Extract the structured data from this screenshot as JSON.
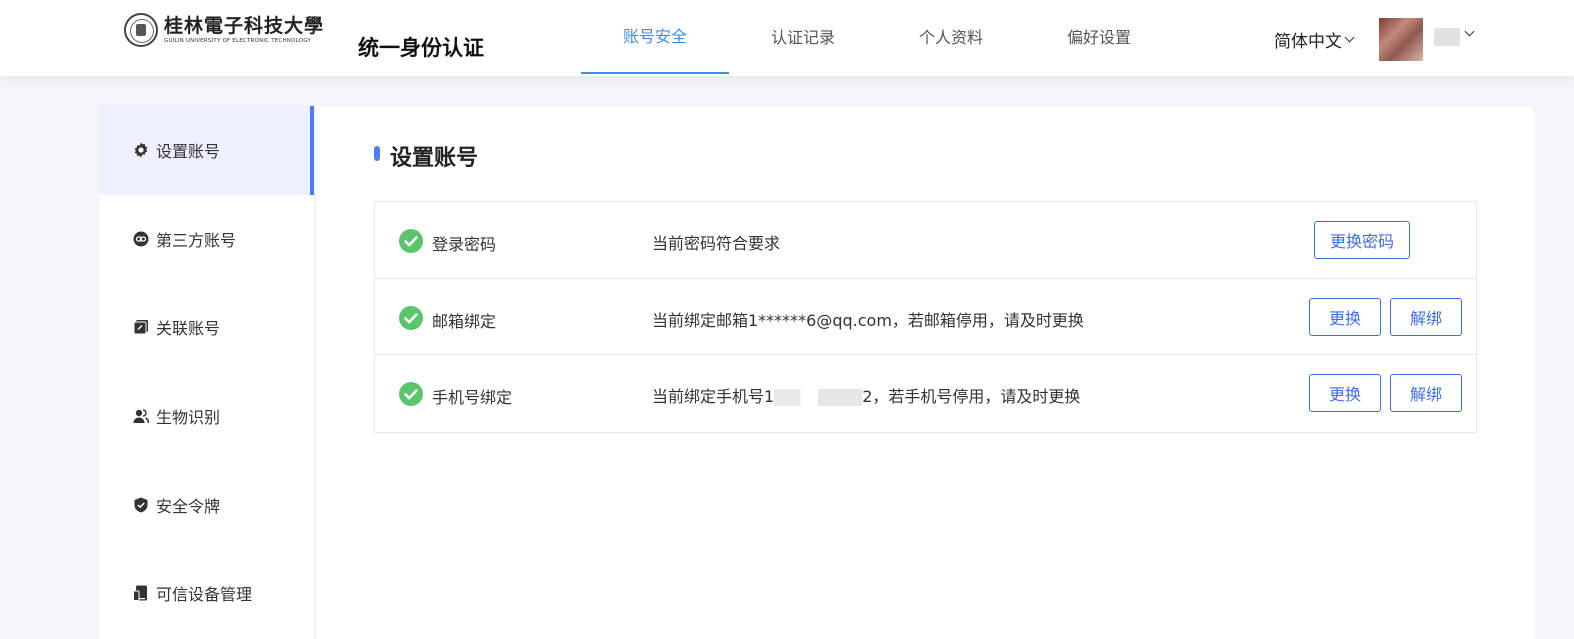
{
  "header": {
    "logo_cn": "桂林電子科技大學",
    "logo_en": "GUILIN UNIVERSITY OF ELECTRONIC TECHNOLOGY",
    "site_title": "统一身份认证",
    "tabs": [
      {
        "label": "账号安全",
        "active": true
      },
      {
        "label": "认证记录",
        "active": false
      },
      {
        "label": "个人资料",
        "active": false
      },
      {
        "label": "偏好设置",
        "active": false
      }
    ],
    "language": "简体中文"
  },
  "sidebar": {
    "items": [
      {
        "label": "设置账号",
        "icon": "gear-icon",
        "active": true
      },
      {
        "label": "第三方账号",
        "icon": "link-icon",
        "active": false
      },
      {
        "label": "关联账号",
        "icon": "linked-card-icon",
        "active": false
      },
      {
        "label": "生物识别",
        "icon": "users-icon",
        "active": false
      },
      {
        "label": "安全令牌",
        "icon": "shield-icon",
        "active": false
      },
      {
        "label": "可信设备管理",
        "icon": "device-icon",
        "active": false
      }
    ]
  },
  "main": {
    "title": "设置账号",
    "rows": [
      {
        "label": "登录密码",
        "desc": "当前密码符合要求",
        "buttons": [
          "更换密码"
        ]
      },
      {
        "label": "邮箱绑定",
        "desc": "当前绑定邮箱1******6@qq.com，若邮箱停用，请及时更换",
        "buttons": [
          "更换",
          "解绑"
        ]
      },
      {
        "label": "手机号绑定",
        "desc_prefix": "当前绑定手机号1",
        "desc_suffix": "2，若手机号停用，请及时更换",
        "buttons": [
          "更换",
          "解绑"
        ]
      }
    ]
  },
  "colors": {
    "accent": "#3b8ff2",
    "button": "#3e6ee6",
    "success": "#5cc46c",
    "sidebar_active_bg": "#eef1fd"
  }
}
